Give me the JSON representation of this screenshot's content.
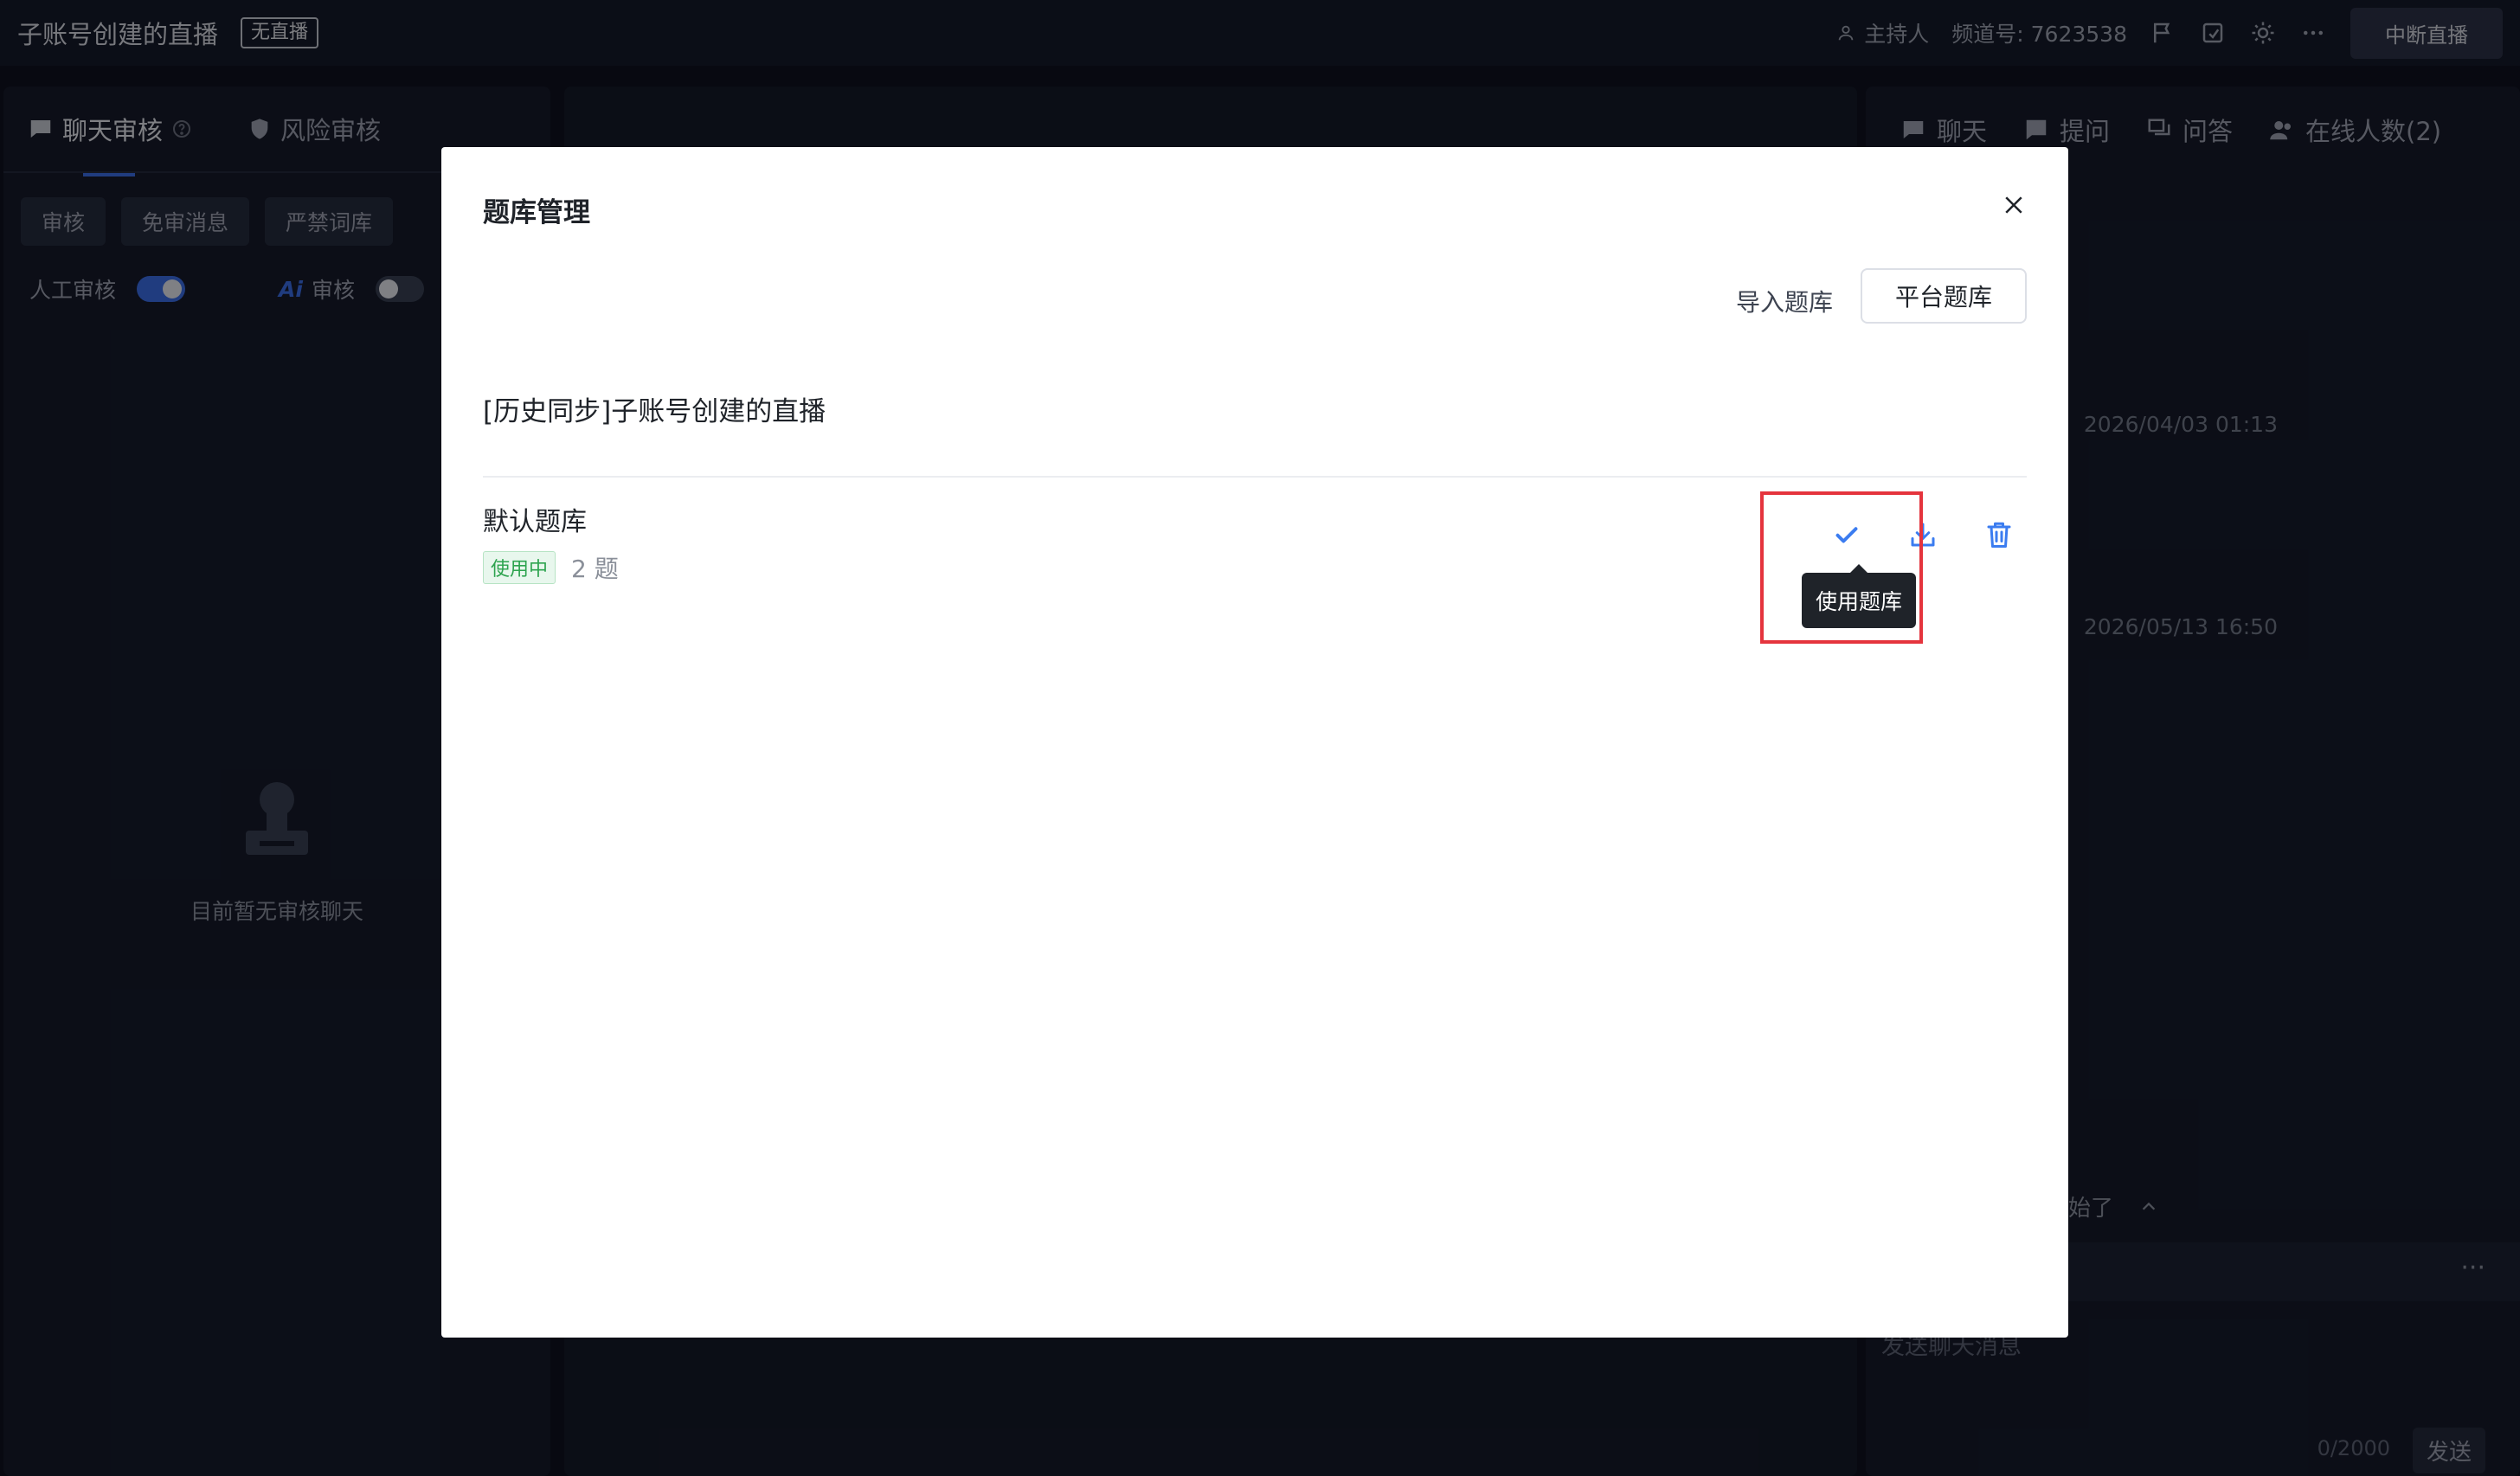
{
  "app": {
    "title": "子账号创建的直播",
    "live_badge": "无直播",
    "host_label": "主持人",
    "channel_label": "频道号: 7623538",
    "stop_button": "中断直播"
  },
  "left_panel": {
    "tabs": [
      {
        "label": "聊天审核"
      },
      {
        "label": "风险审核"
      }
    ],
    "chips": [
      "审核",
      "免审消息",
      "严禁词库"
    ],
    "manual_review_label": "人工审核",
    "ai_review_prefix": "Ai",
    "ai_review_label": "审核",
    "empty_text": "目前暂无审核聊天"
  },
  "right_panel": {
    "tabs": [
      {
        "label": "聊天"
      },
      {
        "label": "提问"
      },
      {
        "label": "问答"
      },
      {
        "label": "在线人数(2)"
      }
    ],
    "times": [
      "2026/04/03 01:13",
      "2026/05/13 16:50"
    ],
    "started_text": "开始了",
    "input_placeholder": "发送聊天消息",
    "char_count": "0/2000",
    "send_label": "发送"
  },
  "modal": {
    "title": "题库管理",
    "import_label": "导入题库",
    "platform_label": "平台题库",
    "group_name": "[历史同步]子账号创建的直播",
    "bank": {
      "name": "默认题库",
      "status": "使用中",
      "count": "2 题"
    },
    "tooltip": "使用题库"
  },
  "colors": {
    "accent": "#3b6ee8",
    "icon_blue": "#3b7cf0",
    "highlight": "#e5343d",
    "status_green": "#2ea44f"
  }
}
